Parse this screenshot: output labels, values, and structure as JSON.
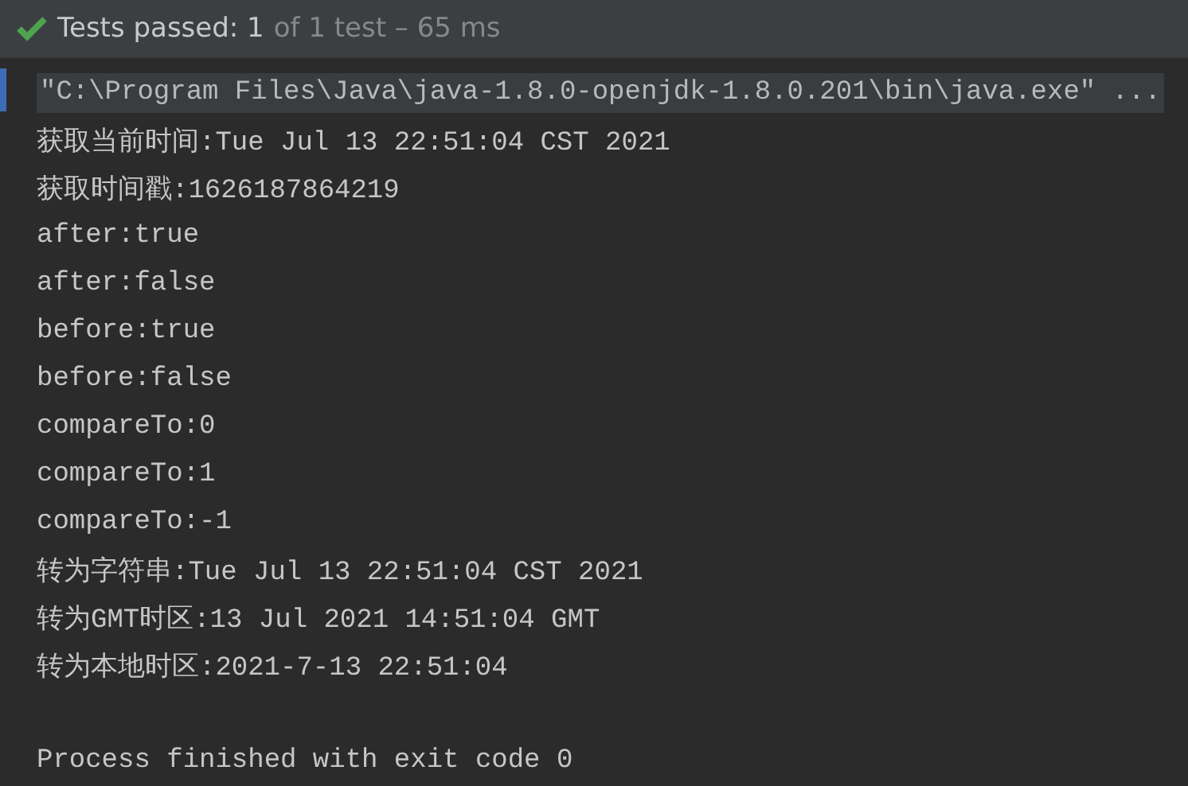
{
  "status_bar": {
    "passed_label": "Tests passed: 1",
    "summary": "of 1 test – 65 ms"
  },
  "console": {
    "command": "\"C:\\Program Files\\Java\\java-1.8.0-openjdk-1.8.0.201\\bin\\java.exe\" ...",
    "lines": [
      "获取当前时间:Tue Jul 13 22:51:04 CST 2021",
      "获取时间戳:1626187864219",
      "after:true",
      "after:false",
      "before:true",
      "before:false",
      "compareTo:0",
      "compareTo:1",
      "compareTo:-1",
      "转为字符串:Tue Jul 13 22:51:04 CST 2021",
      "转为GMT时区:13 Jul 2021 14:51:04 GMT",
      "转为本地时区:2021-7-13 22:51:04"
    ],
    "exit_message": "Process finished with exit code 0"
  }
}
